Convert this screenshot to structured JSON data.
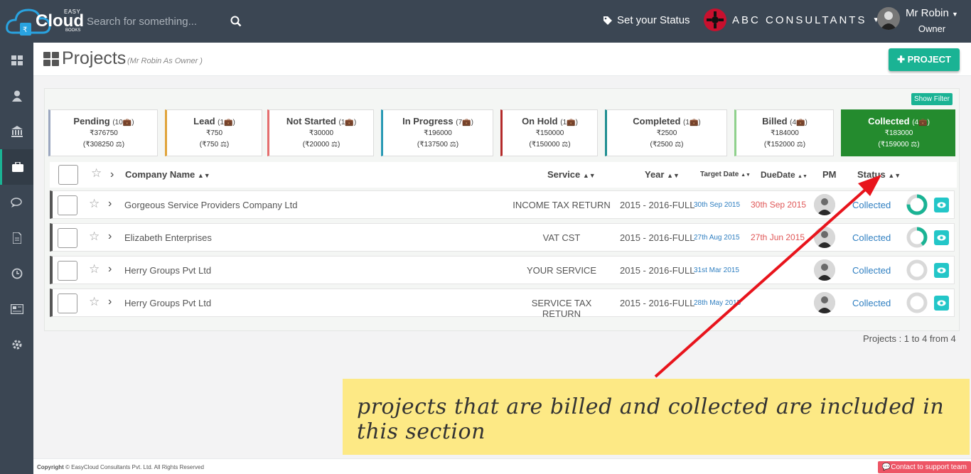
{
  "app": {
    "logo_top": "EASY",
    "logo_main": "Cloud",
    "logo_bottom": "BOOKS",
    "search_placeholder": "Search for something...",
    "status_link": "Set your Status",
    "company": "ABC CONSULTANTS",
    "user_name": "Mr Robin",
    "user_role": "Owner"
  },
  "sidebar": {
    "items": [
      "dashboard-icon",
      "user-icon",
      "bank-icon",
      "briefcase-icon",
      "chat-icon",
      "document-icon",
      "clock-icon",
      "newspaper-icon",
      "gear-icon"
    ],
    "active": "briefcase-icon"
  },
  "header": {
    "title": "Projects",
    "subtitle": "(Mr Robin As Owner )",
    "add_button": "PROJECT"
  },
  "filter_button": "Show Filter",
  "cards": [
    {
      "title": "Pending",
      "count": "(10",
      "amount": "₹376750",
      "sub": "(₹308250",
      "color": "#9ba7c0"
    },
    {
      "title": "Lead",
      "count": "(1",
      "amount": "₹750",
      "sub": "(₹750",
      "color": "#e0a33a"
    },
    {
      "title": "Not Started",
      "count": "(1",
      "amount": "₹30000",
      "sub": "(₹20000",
      "color": "#e56e6e"
    },
    {
      "title": "In Progress",
      "count": "(7",
      "amount": "₹196000",
      "sub": "(₹137500",
      "color": "#2a9ab5"
    },
    {
      "title": "On Hold",
      "count": "(1",
      "amount": "₹150000",
      "sub": "(₹150000",
      "color": "#b42a2a"
    },
    {
      "title": "Completed",
      "count": "(1",
      "amount": "₹2500",
      "sub": "(₹2500",
      "color": "#1f8e91"
    },
    {
      "title": "Billed",
      "count": "(4",
      "amount": "₹184000",
      "sub": "(₹152000",
      "color": "#8fd18c"
    },
    {
      "title": "Collected",
      "count": "(4",
      "amount": "₹183000",
      "sub": "(₹159000",
      "color": "#248b2e"
    }
  ],
  "table": {
    "headers": {
      "company": "Company Name",
      "service": "Service",
      "year": "Year",
      "target": "Target Date",
      "due": "DueDate",
      "pm": "PM",
      "status": "Status"
    },
    "rows": [
      {
        "company": "Gorgeous Service Providers Company Ltd",
        "service": "INCOME TAX RETURN",
        "year": "2015 - 2016-FULL",
        "target": "30th Sep 2015",
        "due": "30th Sep 2015",
        "status": "Collected",
        "progress": 0.75
      },
      {
        "company": "Elizabeth Enterprises",
        "service": "VAT CST",
        "year": "2015 - 2016-FULL",
        "target": "27th Aug 2015",
        "due": "27th Jun 2015",
        "status": "Collected",
        "progress": 0.4
      },
      {
        "company": "Herry Groups Pvt Ltd",
        "service": "YOUR SERVICE",
        "year": "2015 - 2016-FULL",
        "target": "31st Mar 2015",
        "due": "",
        "status": "Collected",
        "progress": 0
      },
      {
        "company": "Herry Groups Pvt Ltd",
        "service": "SERVICE TAX RETURN",
        "year": "2015 - 2016-FULL",
        "target": "28th May 2015",
        "due": "",
        "status": "Collected",
        "progress": 0
      }
    ]
  },
  "pager": "Projects : 1 to 4 from 4",
  "annotation": "projects that are billed and collected are included in this section",
  "footer": {
    "label": "Copyright",
    "text": "© EasyCloud Consultants Pvt. Ltd. All Rights Reserved",
    "support": "Contact to support team"
  },
  "colors": {
    "topbar": "#3b4653",
    "accent": "#1ab394",
    "collected": "#248b2e",
    "annotation": "#fde985",
    "arrow": "#e8141c"
  }
}
